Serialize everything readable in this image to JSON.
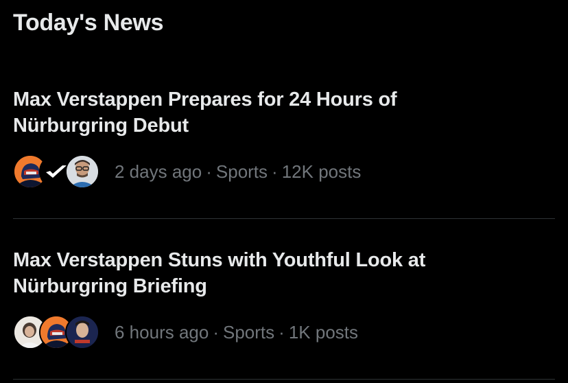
{
  "section": {
    "title": "Today's News"
  },
  "news": [
    {
      "headline": "Max Verstappen Prepares for 24 Hours of Nürburgring Debut",
      "time": "2 days ago",
      "category": "Sports",
      "posts": "12K posts",
      "separator": "·",
      "avatar_icons": [
        "helmet-avatar-icon",
        "checkmark-logo-avatar-icon",
        "man-with-glasses-avatar-icon"
      ]
    },
    {
      "headline": "Max Verstappen Stuns with Youthful Look at Nürburgring Briefing",
      "time": "6 hours ago",
      "category": "Sports",
      "posts": "1K posts",
      "separator": "·",
      "avatar_icons": [
        "photo-avatar-icon",
        "helmet-avatar-icon",
        "driver-avatar-icon"
      ]
    }
  ],
  "colors": {
    "background": "#000000",
    "text_primary": "#e7e9ea",
    "text_secondary": "#71767b",
    "divider": "#2f3336",
    "orange": "#f07a2d",
    "navy": "#1d2a5a"
  }
}
